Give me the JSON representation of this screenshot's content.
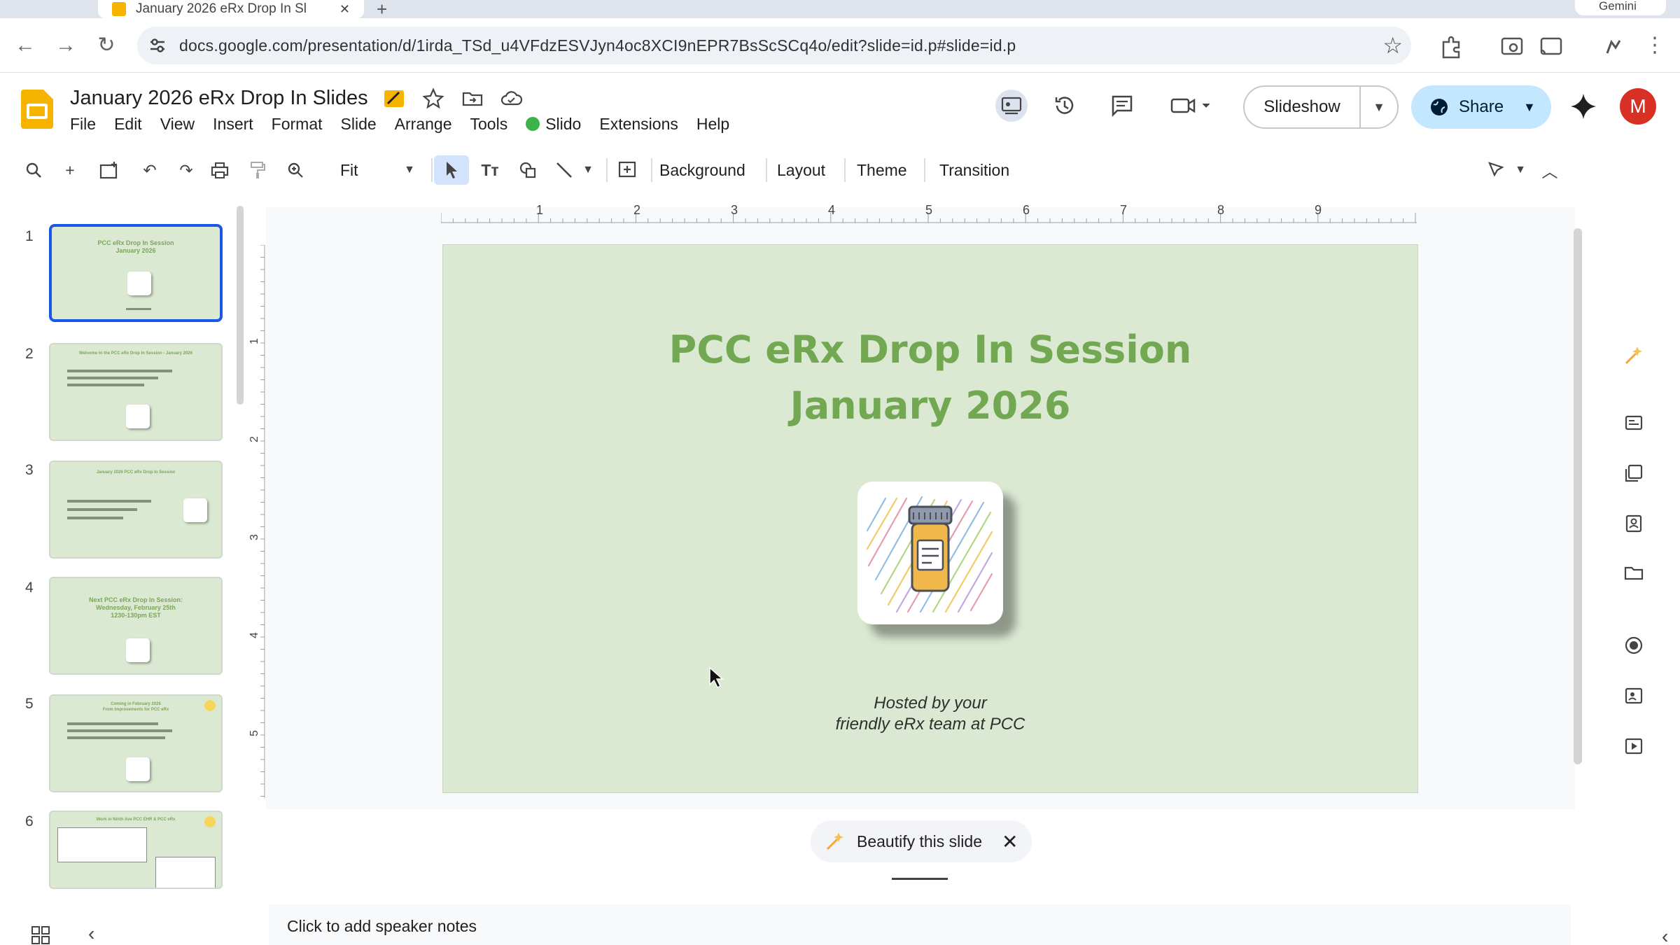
{
  "browser": {
    "tab_title": "January 2026 eRx Drop In Sl",
    "url": "docs.google.com/presentation/d/1irda_TSd_u4VFdzESVJyn4oc8XCI9nEPR7BsScSCq4o/edit?slide=id.p#slide=id.p",
    "gemini_label": "Gemini"
  },
  "doc": {
    "title": "January 2026 eRx Drop In Slides",
    "menu": [
      "File",
      "Edit",
      "View",
      "Insert",
      "Format",
      "Slide",
      "Arrange",
      "Tools",
      "Slido",
      "Extensions",
      "Help"
    ]
  },
  "header": {
    "slideshow_label": "Slideshow",
    "share_label": "Share",
    "avatar_initial": "M"
  },
  "toolbar": {
    "zoom": "Fit",
    "background": "Background",
    "layout": "Layout",
    "theme": "Theme",
    "transition": "Transition"
  },
  "filmstrip": {
    "thumbs": [
      {
        "number": "1",
        "title": "PCC eRx Drop In Session\nJanuary 2026"
      },
      {
        "number": "2",
        "title": "Welcome to the PCC eRx Drop In Session - January 2026"
      },
      {
        "number": "3",
        "title": "January 2026 PCC eRx Drop In Session"
      },
      {
        "number": "4",
        "title": "Next PCC eRx Drop In Session:\nWednesday, February 25th\n1230-130pm EST"
      },
      {
        "number": "5",
        "title": "Coming in February 2026\nFrom Improvements for PCC eRx"
      },
      {
        "number": "6",
        "title": "Work in Ninth Ave PCC EHR & PCC eRx"
      }
    ]
  },
  "ruler": {
    "h_marks": [
      "1",
      "2",
      "3",
      "4",
      "5",
      "6",
      "7",
      "8",
      "9"
    ],
    "v_marks": [
      "1",
      "2",
      "3",
      "4",
      "5"
    ]
  },
  "slide": {
    "title_line1": "PCC eRx Drop In Session",
    "title_line2": "January 2026",
    "subtitle_line1": "Hosted by your",
    "subtitle_line2": "friendly eRx team at PCC",
    "title_color": "#73a852",
    "background_color": "#dbe9d2"
  },
  "beautify": {
    "label": "Beautify this slide"
  },
  "notes": {
    "placeholder": "Click to add speaker notes"
  }
}
